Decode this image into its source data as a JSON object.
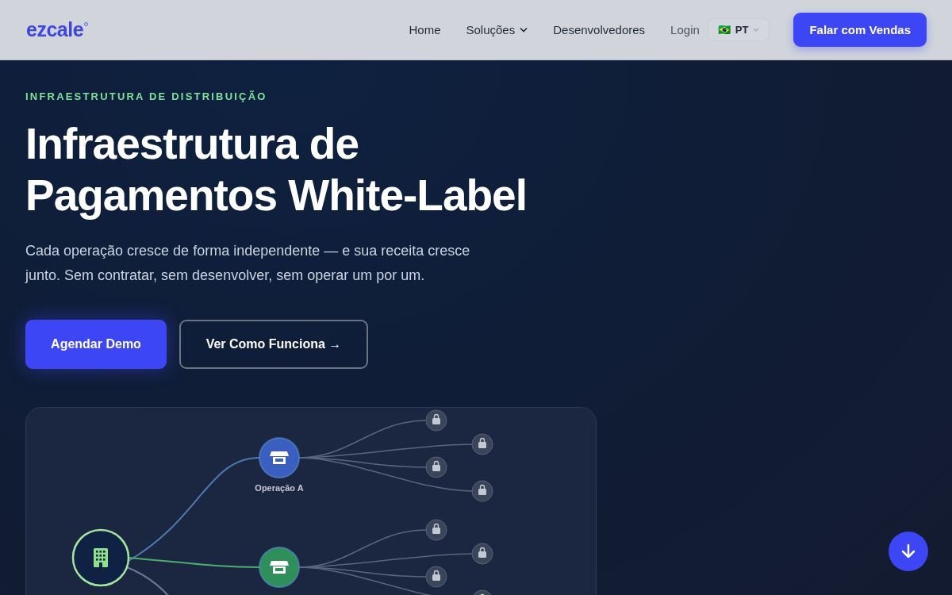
{
  "nav": {
    "logo": "ezcale",
    "links": [
      {
        "label": "Home",
        "dropdown": false
      },
      {
        "label": "Soluções",
        "dropdown": true
      },
      {
        "label": "Desenvolvedores",
        "dropdown": false
      },
      {
        "label": "Login",
        "dropdown": false
      }
    ],
    "language": {
      "flag": "🇧🇷",
      "code": "PT"
    },
    "cta": "Falar com Vendas"
  },
  "hero": {
    "eyebrow": "INFRAESTRUTURA DE DISTRIBUIÇÃO",
    "title_lines": [
      "Infraestrutura de",
      "Pagamentos White-Label"
    ],
    "subtitle": "Cada operação cresce de forma independente — e sua receita cresce junto. Sem contratar, sem desenvolver, sem operar um por um.",
    "primary_button": "Agendar Demo",
    "secondary_button": "Ver Como Funciona →"
  },
  "diagram": {
    "operations": [
      {
        "label": "Operação A",
        "color": "#3b5fc0"
      },
      {
        "color": "#2f8f5a"
      }
    ]
  }
}
